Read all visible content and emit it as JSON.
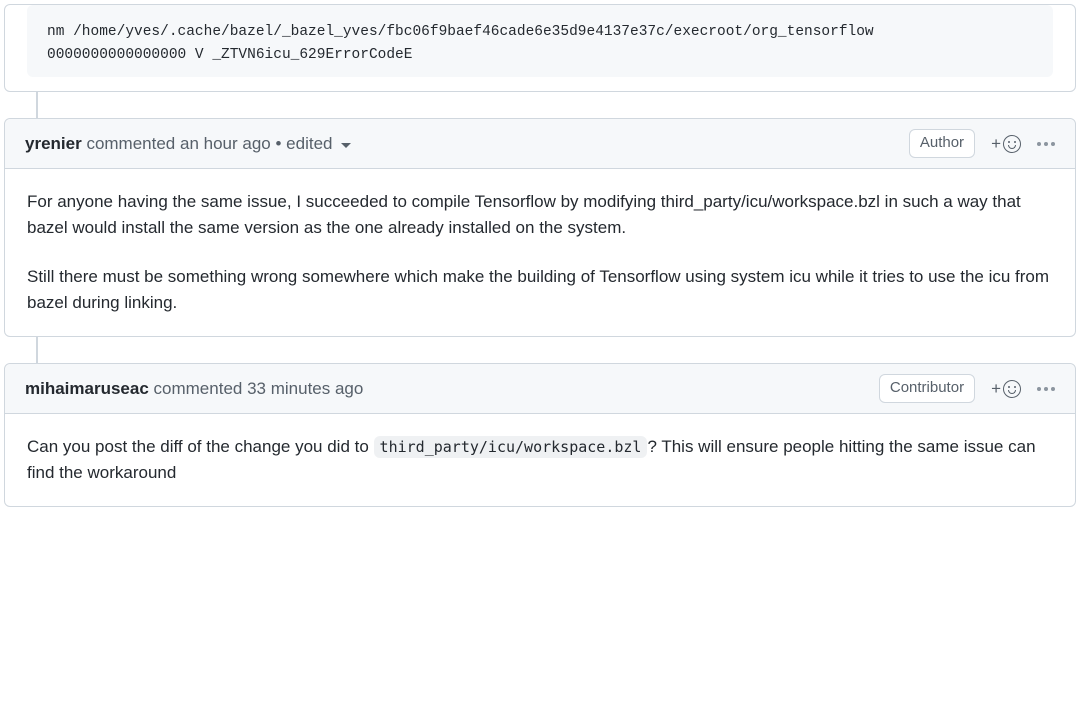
{
  "code": {
    "line1": "nm /home/yves/.cache/bazel/_bazel_yves/fbc06f9baef46cade6e35d9e4137e37c/execroot/org_tensorflow",
    "line2": "0000000000000000 V _ZTVN6icu_629ErrorCodeE"
  },
  "comments": [
    {
      "username": "yrenier",
      "action": "commented",
      "timestamp": "an hour ago",
      "edited_label": "edited",
      "badge": "Author",
      "paragraphs": [
        "For anyone having the same issue, I succeeded to compile Tensorflow by modifying third_party/icu/workspace.bzl in such a way that bazel would install the same version as the one already installed on the system.",
        "Still there must be something wrong somewhere which make the building of Tensorflow using system icu while it tries to use the icu from bazel during linking."
      ]
    },
    {
      "username": "mihaimaruseac",
      "action": "commented",
      "timestamp": "33 minutes ago",
      "badge": "Contributor",
      "body_prefix": "Can you post the diff of the change you did to ",
      "body_code": "third_party/icu/workspace.bzl",
      "body_suffix": "? This will ensure people hitting the same issue can find the workaround"
    }
  ]
}
